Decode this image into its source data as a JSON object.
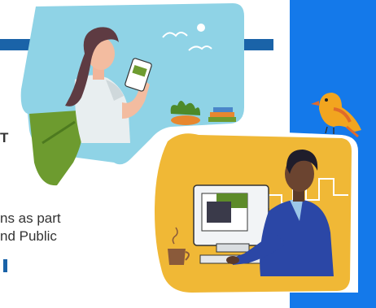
{
  "text": {
    "heading_fragment": "T",
    "lines": [
      "ns as part",
      "nd Public"
    ]
  },
  "colors": {
    "blue_panel": "#1479ea",
    "strip": "#1a63a8",
    "sky": "#87d0e4",
    "yellow": "#f0b836",
    "green": "#5a8f2a"
  },
  "illustration": {
    "top_scene": "woman-holding-phone",
    "bottom_scene": "man-at-computer",
    "bird": "orange-bird"
  }
}
